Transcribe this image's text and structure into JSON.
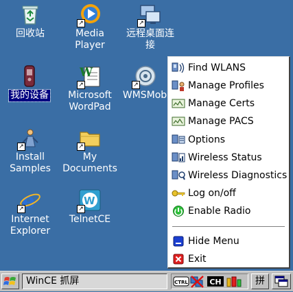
{
  "colors": {
    "desktop": "#3a6ea5",
    "menu_bg": "#ffffff",
    "taskbar": "#c0c0c0",
    "selection": "#000080"
  },
  "desktop": {
    "icons": [
      {
        "label": "回收站",
        "icon": "recycle-bin-icon",
        "shortcut": false
      },
      {
        "label": "Media\nPlayer",
        "icon": "media-player-icon",
        "shortcut": true
      },
      {
        "label": "远程桌面连\n接",
        "icon": "remote-desktop-icon",
        "shortcut": true
      },
      {
        "label": "我的设备",
        "icon": "my-device-icon",
        "shortcut": false,
        "selected": true
      },
      {
        "label": "Microsoft\nWordPad",
        "icon": "wordpad-icon",
        "shortcut": true
      },
      {
        "label": "WMSMob",
        "icon": "wmsmob-icon",
        "shortcut": true
      },
      {
        "label": "Install\nSamples",
        "icon": "install-samples-icon",
        "shortcut": true
      },
      {
        "label": "My\nDocuments",
        "icon": "folder-icon",
        "shortcut": true
      },
      {
        "label": "Internet\nExplorer",
        "icon": "internet-explorer-icon",
        "shortcut": true
      },
      {
        "label": "TelnetCE",
        "icon": "telnetce-icon",
        "shortcut": true
      }
    ]
  },
  "menu": {
    "items": [
      {
        "label": "Find WLANS",
        "icon": "find-wlans-icon"
      },
      {
        "label": "Manage Profiles",
        "icon": "manage-profiles-icon"
      },
      {
        "label": "Manage Certs",
        "icon": "manage-certs-icon"
      },
      {
        "label": "Manage PACS",
        "icon": "manage-pacs-icon"
      },
      {
        "label": "Options",
        "icon": "options-icon"
      },
      {
        "label": "Wireless Status",
        "icon": "wireless-status-icon"
      },
      {
        "label": "Wireless Diagnostics",
        "icon": "wireless-diagnostics-icon"
      },
      {
        "label": "Log on/off",
        "icon": "key-icon"
      },
      {
        "label": "Enable Radio",
        "icon": "power-icon"
      },
      {
        "label": "Hide Menu",
        "icon": "hide-menu-icon"
      },
      {
        "label": "Exit",
        "icon": "exit-icon"
      }
    ]
  },
  "taskbar": {
    "start_icon": "windows-logo-icon",
    "task_label": "WinCE 抓屏",
    "tray": {
      "ctrl_label": "CTRL",
      "ch_label": "CH"
    },
    "ime_label": "拼",
    "desktop_icon": "show-desktop-icon"
  }
}
